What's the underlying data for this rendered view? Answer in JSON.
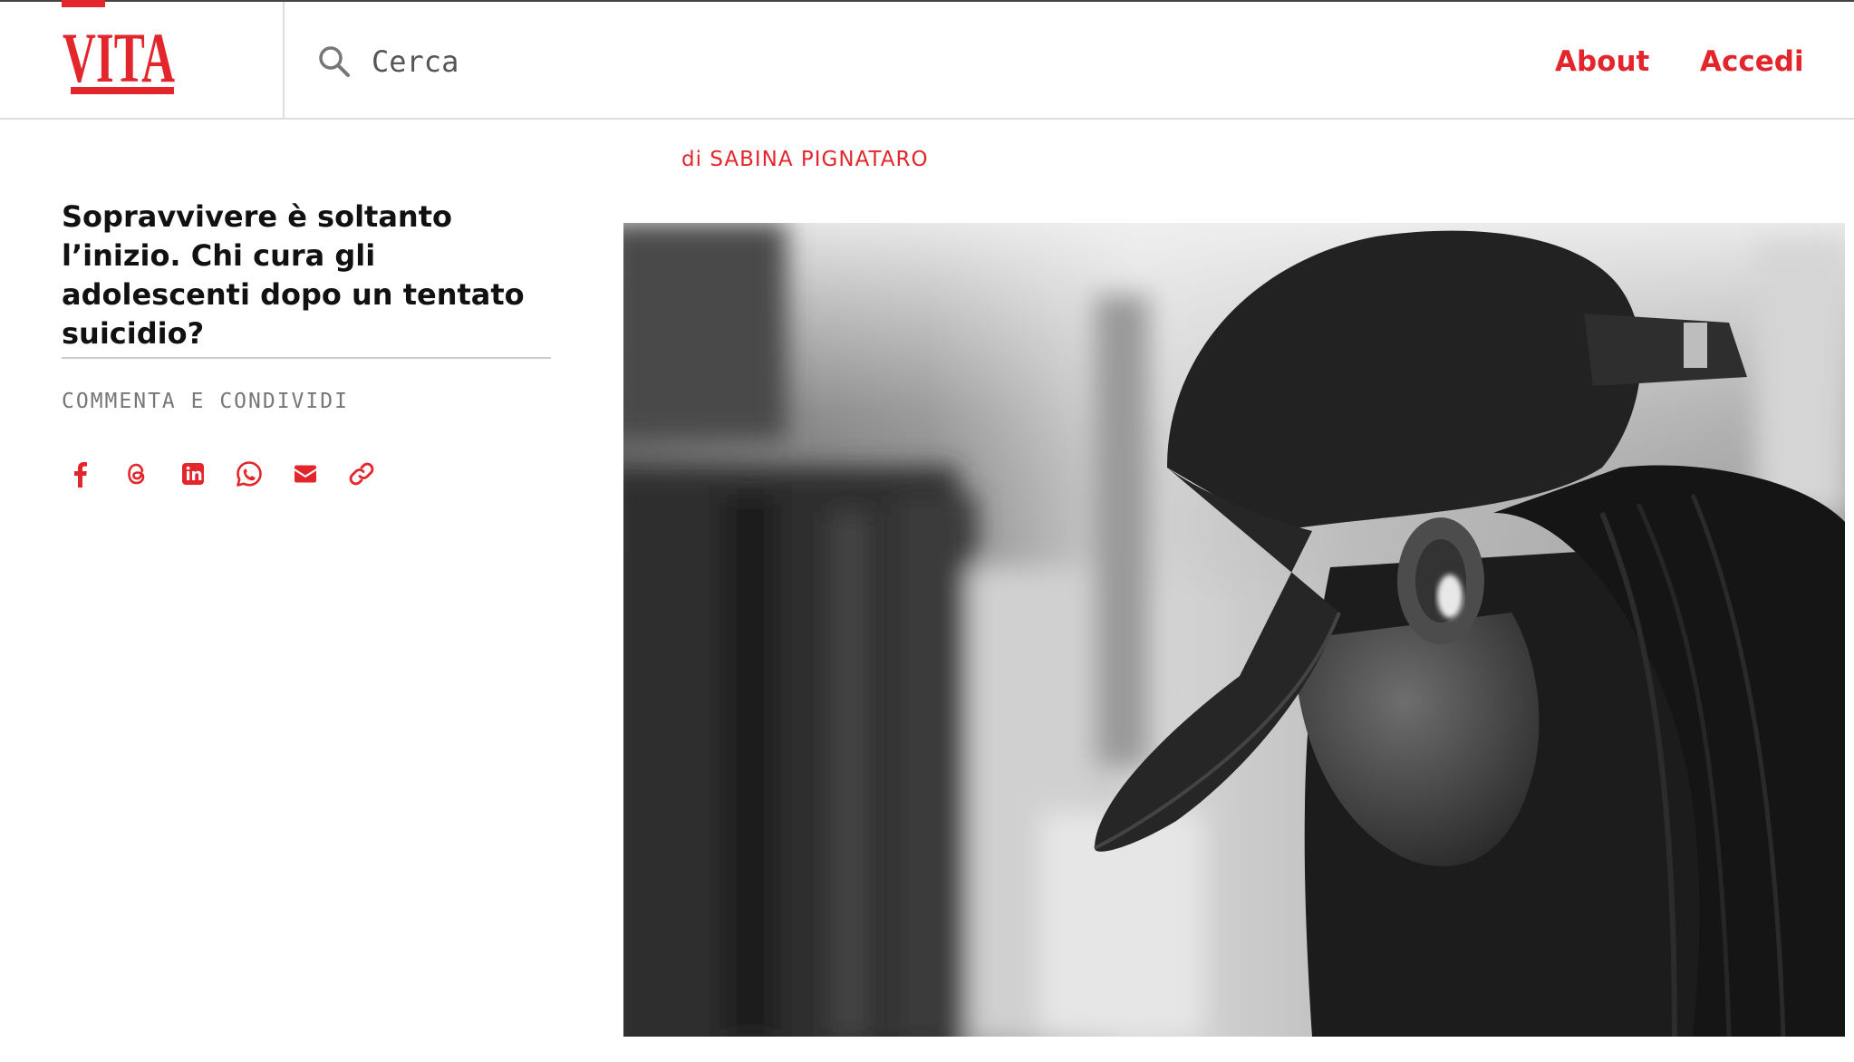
{
  "brand": {
    "logo_text": "VITA",
    "accent_color": "#e3262c"
  },
  "search": {
    "placeholder": "Cerca",
    "icon": "search-icon"
  },
  "nav": {
    "about": "About",
    "login": "Accedi"
  },
  "article": {
    "byline_prefix": "di",
    "author": "SABINA PIGNATARO",
    "title": "Sopravvivere è soltanto l’inizio. Chi cura gli adolescenti dopo un tentato suicidio?",
    "share_label": "COMMENTA E CONDIVIDI",
    "share_icons": [
      "facebook-icon",
      "threads-icon",
      "linkedin-icon",
      "whatsapp-icon",
      "email-icon",
      "link-icon"
    ]
  }
}
